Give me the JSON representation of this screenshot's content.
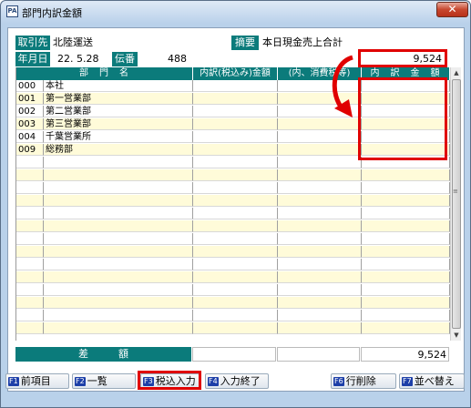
{
  "window": {
    "title": "部門内訳金額",
    "icon": "app-icon",
    "close_glyph": "✕"
  },
  "header": {
    "torihikisaki_label": "取引先",
    "torihikisaki_value": "北陸運送",
    "tekiyo_label": "摘要",
    "tekiyo_value": "本日現金売上合計",
    "date_label": "年月日",
    "date_value": "22. 5.28",
    "denban_label": "伝番",
    "denban_value": "488",
    "total_amount": "9,524"
  },
  "table": {
    "columns": [
      "部　門　名",
      "内訳(税込み)金額",
      "(内、消費税等)",
      "内　訳　金　額"
    ],
    "rows": [
      {
        "code": "000",
        "name": "本社"
      },
      {
        "code": "001",
        "name": "第一営業部"
      },
      {
        "code": "002",
        "name": "第二営業部"
      },
      {
        "code": "003",
        "name": "第三営業部"
      },
      {
        "code": "004",
        "name": "千葉営業所"
      },
      {
        "code": "009",
        "name": "総務部"
      }
    ]
  },
  "footer": {
    "diff_label": "差　　　額",
    "diff_value": "9,524"
  },
  "fkeys": [
    {
      "key": "F1",
      "label": "前項目"
    },
    {
      "key": "F2",
      "label": "一覧"
    },
    {
      "key": "F3",
      "label": "税込入力"
    },
    {
      "key": "F4",
      "label": "入力終了"
    },
    {
      "key": "F6",
      "label": "行削除"
    },
    {
      "key": "F7",
      "label": "並べ替え"
    }
  ],
  "colors": {
    "header_teal": "#0b7b7b",
    "row_stripe": "#fffbd9",
    "highlight_red": "#e00000"
  }
}
